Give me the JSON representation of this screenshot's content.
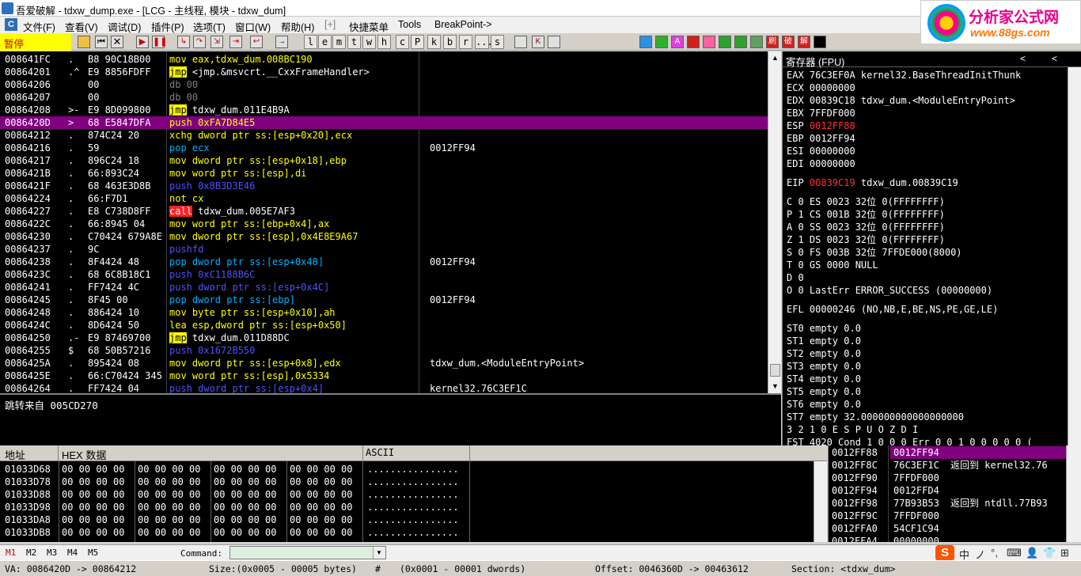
{
  "window": {
    "title": "吾爱破解 - tdxw_dump.exe - [LCG - 主线程, 模块 - tdxw_dum]"
  },
  "menu": [
    "文件(F)",
    "查看(V)",
    "调试(D)",
    "插件(P)",
    "选项(T)",
    "窗口(W)",
    "帮助(H)",
    "[+]",
    "快捷菜单",
    "Tools",
    "BreakPoint->"
  ],
  "toolbar": {
    "status": "暂停",
    "letters": [
      "l",
      "e",
      "m",
      "t",
      "w",
      "h",
      "c",
      "P",
      "k",
      "b",
      "r",
      "...",
      "s"
    ],
    "icon_names": [
      "open-icon",
      "restart-icon",
      "close-icon",
      "run-icon",
      "pause-icon",
      "step-into-icon",
      "step-over-icon",
      "trace-into-icon",
      "trace-over-icon",
      "execute-till-return-icon",
      "goto-icon"
    ],
    "right_icons": [
      "刷",
      "破",
      "解"
    ]
  },
  "banner": {
    "title": "分析家公式网",
    "url": "www.88gs.com"
  },
  "cpu": {
    "rows": [
      {
        "addr": "008641FC",
        "mark": ".",
        "hex": "B8 90C18B00",
        "asm": "mov eax,tdxw_dum.008BC190",
        "cmt": ""
      },
      {
        "addr": "00864201",
        "mark": ".^",
        "hex": "E9 8856FDFF",
        "asm": "jmp <jmp.&msvcrt.__CxxFrameHandler>",
        "cmt": ""
      },
      {
        "addr": "00864206",
        "mark": "",
        "hex": "00",
        "asm": "db 00",
        "cmt": ""
      },
      {
        "addr": "00864207",
        "mark": "",
        "hex": "00",
        "asm": "db 00",
        "cmt": ""
      },
      {
        "addr": "00864208",
        "mark": ">-",
        "hex": "E9 8D099800",
        "asm": "jmp tdxw_dum.011E4B9A",
        "cmt": ""
      },
      {
        "addr": "0086420D",
        "mark": ">",
        "hex": "68 E5847DFA",
        "asm": "push 0xFA7D84E5",
        "cmt": ""
      },
      {
        "addr": "00864212",
        "mark": ".",
        "hex": "874C24 20",
        "asm": "xchg dword ptr ss:[esp+0x20],ecx",
        "cmt": ""
      },
      {
        "addr": "00864216",
        "mark": ".",
        "hex": "59",
        "asm": "pop ecx",
        "cmt": "0012FF94"
      },
      {
        "addr": "00864217",
        "mark": ".",
        "hex": "896C24 18",
        "asm": "mov dword ptr ss:[esp+0x18],ebp",
        "cmt": ""
      },
      {
        "addr": "0086421B",
        "mark": ".",
        "hex": "66:893C24",
        "asm": "mov word ptr ss:[esp],di",
        "cmt": ""
      },
      {
        "addr": "0086421F",
        "mark": ".",
        "hex": "68 463E3D8B",
        "asm": "push 0x8B3D3E46",
        "cmt": ""
      },
      {
        "addr": "00864224",
        "mark": ".",
        "hex": "66:F7D1",
        "asm": "not cx",
        "cmt": ""
      },
      {
        "addr": "00864227",
        "mark": ".",
        "hex": "E8 C738D8FF",
        "asm": "call tdxw_dum.005E7AF3",
        "cmt": ""
      },
      {
        "addr": "0086422C",
        "mark": ".",
        "hex": "66:8945 04",
        "asm": "mov word ptr ss:[ebp+0x4],ax",
        "cmt": ""
      },
      {
        "addr": "00864230",
        "mark": ".",
        "hex": "C70424 679A8E",
        "asm": "mov dword ptr ss:[esp],0x4E8E9A67",
        "cmt": ""
      },
      {
        "addr": "00864237",
        "mark": ".",
        "hex": "9C",
        "asm": "pushfd",
        "cmt": ""
      },
      {
        "addr": "00864238",
        "mark": ".",
        "hex": "8F4424 48",
        "asm": "pop dword ptr ss:[esp+0x48]",
        "cmt": "0012FF94"
      },
      {
        "addr": "0086423C",
        "mark": ".",
        "hex": "68 6C8B18C1",
        "asm": "push 0xC1188B6C",
        "cmt": ""
      },
      {
        "addr": "00864241",
        "mark": ".",
        "hex": "FF7424 4C",
        "asm": "push dword ptr ss:[esp+0x4C]",
        "cmt": ""
      },
      {
        "addr": "00864245",
        "mark": ".",
        "hex": "8F45 00",
        "asm": "pop dword ptr ss:[ebp]",
        "cmt": "0012FF94"
      },
      {
        "addr": "00864248",
        "mark": ".",
        "hex": "886424 10",
        "asm": "mov byte ptr ss:[esp+0x10],ah",
        "cmt": ""
      },
      {
        "addr": "0086424C",
        "mark": ".",
        "hex": "8D6424 50",
        "asm": "lea esp,dword ptr ss:[esp+0x50]",
        "cmt": ""
      },
      {
        "addr": "00864250",
        "mark": ".-",
        "hex": "E9 87469700",
        "asm": "jmp tdxw_dum.011D88DC",
        "cmt": ""
      },
      {
        "addr": "00864255",
        "mark": "$",
        "hex": "68 50B57216",
        "asm": "push 0x1672B550",
        "cmt": ""
      },
      {
        "addr": "0086425A",
        "mark": ".",
        "hex": "895424 08",
        "asm": "mov dword ptr ss:[esp+0x8],edx",
        "cmt": "tdxw_dum.<ModuleEntryPoint>"
      },
      {
        "addr": "0086425E",
        "mark": ".",
        "hex": "66:C70424 345",
        "asm": "mov word ptr ss:[esp],0x5334",
        "cmt": ""
      },
      {
        "addr": "00864264",
        "mark": ".",
        "hex": "FF7424 04",
        "asm": "push dword ptr ss:[esp+0x4]",
        "cmt": "kernel32.76C3EF1C"
      }
    ],
    "selected_index": 5,
    "info": "跳转来自 005CD270"
  },
  "registers": {
    "title": "寄存器 (FPU)",
    "nav": [
      "<",
      "<"
    ],
    "lines": [
      "EAX 76C3EF0A kernel32.BaseThreadInitThunk",
      "ECX 00000000",
      "EDX 00839C18 tdxw_dum.<ModuleEntryPoint>",
      "EBX 7FFDF000",
      "ESP 0012FF88",
      "EBP 0012FF94",
      "ESI 00000000",
      "EDI 00000000",
      "",
      "EIP 00839C19 tdxw_dum.00839C19",
      "",
      "C 0  ES 0023 32位 0(FFFFFFFF)",
      "P 1  CS 001B 32位 0(FFFFFFFF)",
      "A 0  SS 0023 32位 0(FFFFFFFF)",
      "Z 1  DS 0023 32位 0(FFFFFFFF)",
      "S 0  FS 003B 32位 7FFDE000(8000)",
      "T 0  GS 0000 NULL",
      "D 0",
      "O 0  LastErr ERROR_SUCCESS (00000000)",
      "",
      "EFL 00000246 (NO,NB,E,BE,NS,PE,GE,LE)",
      "",
      "ST0 empty 0.0",
      "ST1 empty 0.0",
      "ST2 empty 0.0",
      "ST3 empty 0.0",
      "ST4 empty 0.0",
      "ST5 empty 0.0",
      "ST6 empty 0.0",
      "ST7 empty 32.000000000000000000",
      "               3 2 1 0      E S P U O Z D I",
      "FST 4020  Cond 1 0 0 0  Err 0 0 1 0 0 0 0 0  ("
    ],
    "red_values": [
      "0012FF88",
      "00839C19"
    ]
  },
  "dump": {
    "headers": [
      "地址",
      "HEX 数据",
      "ASCII"
    ],
    "rows": [
      {
        "addr": "01033D68",
        "hex": [
          "00 00 00 00",
          "00 00 00 00",
          "00 00 00 00",
          "00 00 00 00"
        ],
        "ascii": "................"
      },
      {
        "addr": "01033D78",
        "hex": [
          "00 00 00 00",
          "00 00 00 00",
          "00 00 00 00",
          "00 00 00 00"
        ],
        "ascii": "................"
      },
      {
        "addr": "01033D88",
        "hex": [
          "00 00 00 00",
          "00 00 00 00",
          "00 00 00 00",
          "00 00 00 00"
        ],
        "ascii": "................"
      },
      {
        "addr": "01033D98",
        "hex": [
          "00 00 00 00",
          "00 00 00 00",
          "00 00 00 00",
          "00 00 00 00"
        ],
        "ascii": "................"
      },
      {
        "addr": "01033DA8",
        "hex": [
          "00 00 00 00",
          "00 00 00 00",
          "00 00 00 00",
          "00 00 00 00"
        ],
        "ascii": "................"
      },
      {
        "addr": "01033DB8",
        "hex": [
          "00 00 00 00",
          "00 00 00 00",
          "00 00 00 00",
          "00 00 00 00"
        ],
        "ascii": "................"
      }
    ]
  },
  "stack": {
    "rows": [
      {
        "addr": "0012FF88",
        "val": "0012FF94",
        "cmt": ""
      },
      {
        "addr": "0012FF8C",
        "val": "76C3EF1C",
        "cmt": "返回到 kernel32.76"
      },
      {
        "addr": "0012FF90",
        "val": "7FFDF000",
        "cmt": ""
      },
      {
        "addr": "0012FF94",
        "val": "0012FFD4",
        "cmt": ""
      },
      {
        "addr": "0012FF98",
        "val": "77B93B53",
        "cmt": "返回到 ntdll.77B93"
      },
      {
        "addr": "0012FF9C",
        "val": "7FFDF000",
        "cmt": ""
      },
      {
        "addr": "0012FFA0",
        "val": "54CF1C94",
        "cmt": ""
      },
      {
        "addr": "0012FFA4",
        "val": "00000000",
        "cmt": ""
      }
    ]
  },
  "cmdbar": {
    "tabs": [
      "M1",
      "M2",
      "M3",
      "M4",
      "M5"
    ],
    "label": "Command:",
    "value": ""
  },
  "tray": {
    "icons": [
      "中",
      "ノ",
      "°,",
      "⌨",
      "👤",
      "👕",
      "⊞"
    ]
  },
  "status": {
    "va": "VA: 0086420D -> 00864212",
    "size": "Size:(0x0005 - 00005 bytes)",
    "hash": "#",
    "dwords": "(0x0001 - 00001 dwords)",
    "offset": "Offset: 0046360D -> 00463612",
    "section": "Section: <tdxw_dum>"
  }
}
